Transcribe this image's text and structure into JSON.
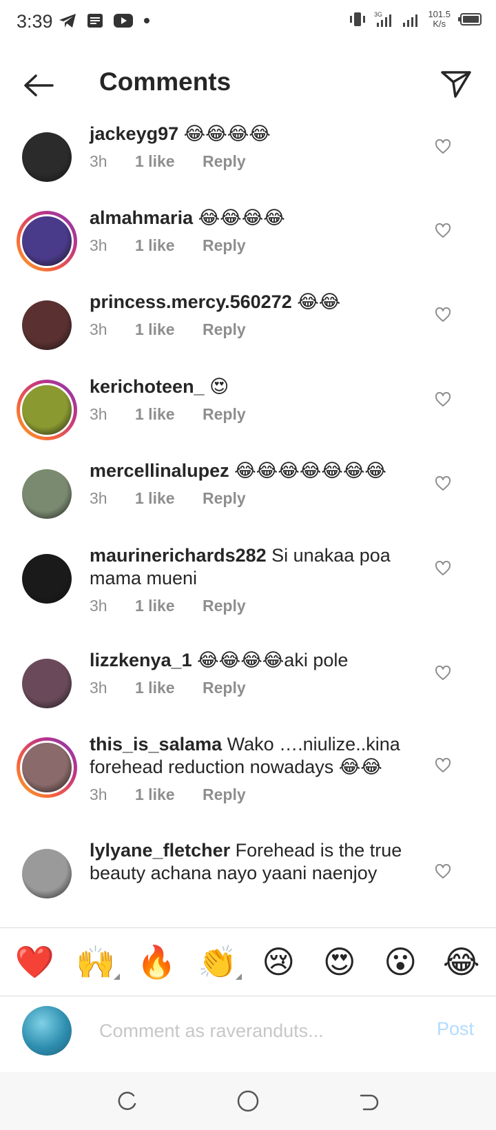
{
  "status_bar": {
    "time": "3:39",
    "net_speed_value": "101.5",
    "net_speed_unit": "K/s",
    "icons": [
      "telegram-icon",
      "document-icon",
      "youtube-icon",
      "dot-icon",
      "vibrate-icon",
      "signal-3g-icon",
      "signal-icon",
      "battery-icon"
    ]
  },
  "header": {
    "title": "Comments",
    "back_icon": "arrow-left-icon",
    "share_icon": "send-icon"
  },
  "comments": [
    {
      "username": "jackeyg97",
      "text": "😂😂😂😂",
      "time": "3h",
      "likes": "1 like",
      "reply": "Reply",
      "ring": false,
      "avatar_color": "#2b2b2b"
    },
    {
      "username": "almahmaria",
      "text": "😂😂😂😂",
      "time": "3h",
      "likes": "1 like",
      "reply": "Reply",
      "ring": true,
      "avatar_color": "#4a3a8a"
    },
    {
      "username": "princess.mercy.560272",
      "text": "😂😂",
      "time": "3h",
      "likes": "1 like",
      "reply": "Reply",
      "ring": false,
      "avatar_color": "#5a3030"
    },
    {
      "username": "kerichoteen_",
      "text": "😍",
      "time": "3h",
      "likes": "1 like",
      "reply": "Reply",
      "ring": true,
      "avatar_color": "#8a9a30"
    },
    {
      "username": "mercellinalupez",
      "text": "😂😂😂😂😂😂😂",
      "time": "3h",
      "likes": "1 like",
      "reply": "Reply",
      "ring": false,
      "avatar_color": "#7a8a70"
    },
    {
      "username": "maurinerichards282",
      "text": "Si unakaa poa mama mueni",
      "time": "3h",
      "likes": "1 like",
      "reply": "Reply",
      "ring": false,
      "avatar_color": "#1a1a1a"
    },
    {
      "username": "lizzkenya_1",
      "text": "😂😂😂😂aki pole",
      "time": "3h",
      "likes": "1 like",
      "reply": "Reply",
      "ring": false,
      "avatar_color": "#6a4a5a"
    },
    {
      "username": "this_is_salama",
      "text": "Wako ….niulize..kina forehead reduction nowadays 😂😂",
      "time": "3h",
      "likes": "1 like",
      "reply": "Reply",
      "ring": true,
      "avatar_color": "#8a6a6a"
    },
    {
      "username": "lylyane_fletcher",
      "text": "Forehead is the true beauty achana nayo yaani naenjoy",
      "time": "",
      "likes": "",
      "reply": "",
      "ring": false,
      "avatar_color": "#9a9a9a"
    }
  ],
  "emoji_bar": [
    {
      "char": "❤️",
      "name": "heart-emoji",
      "tone": false
    },
    {
      "char": "🙌",
      "name": "raising-hands-emoji",
      "tone": true
    },
    {
      "char": "🔥",
      "name": "fire-emoji",
      "tone": false
    },
    {
      "char": "👏",
      "name": "clapping-emoji",
      "tone": true
    },
    {
      "char": "😢",
      "name": "crying-emoji",
      "tone": false
    },
    {
      "char": "😍",
      "name": "heart-eyes-emoji",
      "tone": false
    },
    {
      "char": "😮",
      "name": "surprised-emoji",
      "tone": false
    },
    {
      "char": "😂",
      "name": "laughing-emoji",
      "tone": false
    }
  ],
  "compose": {
    "placeholder": "Comment as raveranduts...",
    "post_label": "Post"
  },
  "colors": {
    "text": "#262626",
    "meta": "#8e8e8e",
    "post_disabled": "#b3dbff"
  }
}
